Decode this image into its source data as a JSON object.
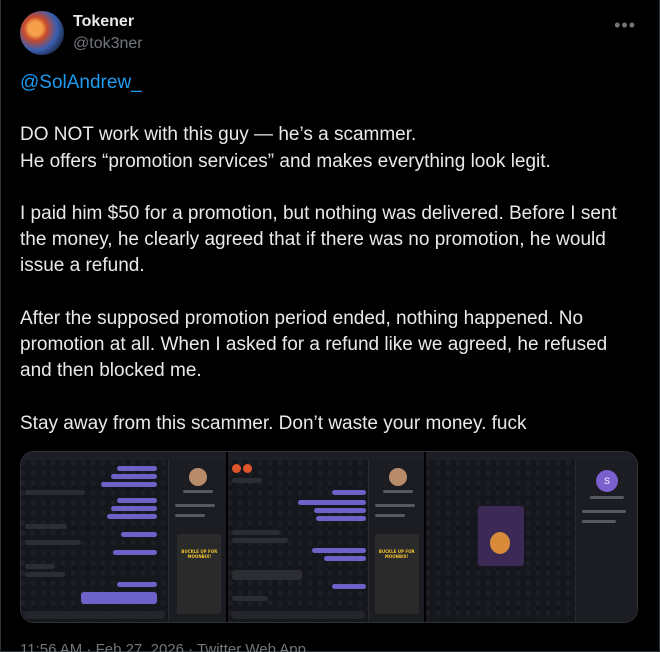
{
  "author": {
    "name": "Tokener",
    "handle": "@tok3ner"
  },
  "tweet": {
    "mention": "@SolAndrew_",
    "paragraphs": [
      "DO NOT work with this guy — he’s a scammer.\nHe offers “promotion services” and makes everything look legit.",
      "I paid him $50 for a promotion, but nothing was delivered. Before I sent the money, he clearly agreed that if there was no promotion, he would issue a refund.",
      "After the supposed promotion period ended, nothing happened. No promotion at all.  When I asked for a refund like we agreed, he refused and then blocked me.",
      "Stay away from this scammer. Don’t waste your money. fuck"
    ]
  },
  "media": {
    "poster_text": "BUCKLE UP FOR MOONBIX!",
    "info_avatar_letter": "S"
  },
  "footer": {
    "meta": "11:56 AM · Feb 27, 2026 · Twitter Web App"
  },
  "colors": {
    "background": "#000000",
    "text": "#e7e9ea",
    "muted": "#71767b",
    "link": "#1d9bf0",
    "outgoing_bubble": "#6d62c7"
  },
  "icons": {
    "more": "more-dots-icon"
  }
}
